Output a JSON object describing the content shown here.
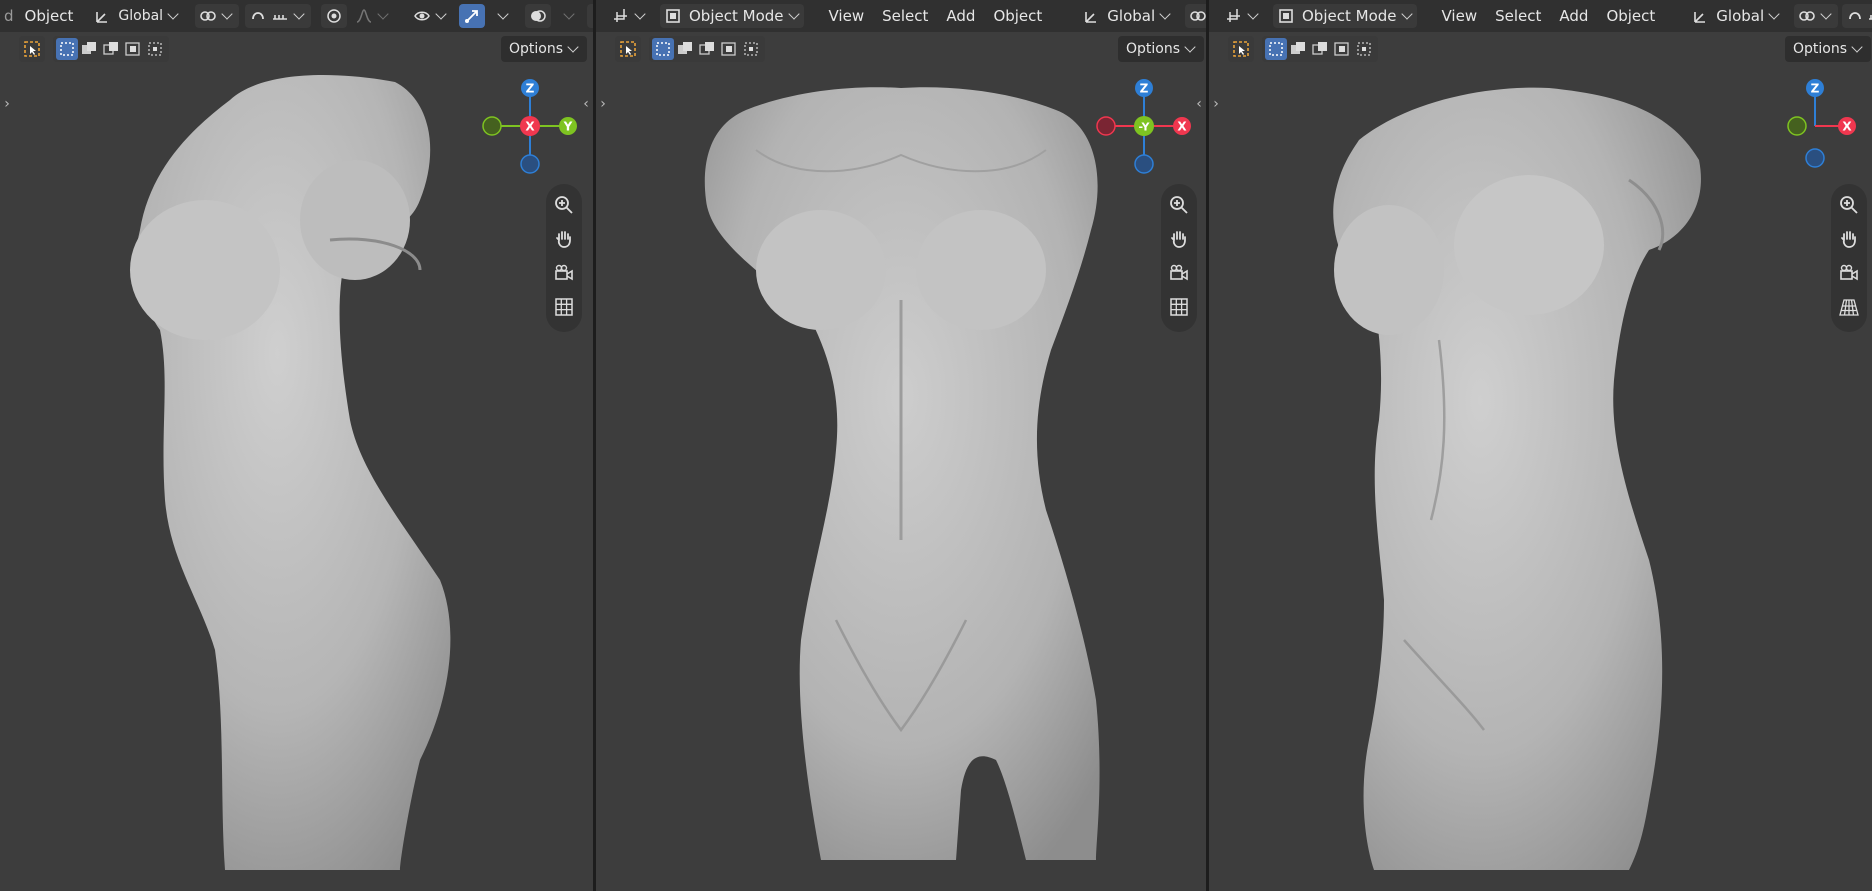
{
  "panes": [
    {
      "header": {
        "partial_label": "d",
        "object_menu": "Object",
        "orientation": "Global"
      },
      "options_label": "Options",
      "gizmo": {
        "up": "Z",
        "center": "X",
        "right": "Y"
      }
    },
    {
      "header": {
        "mode": "Object Mode",
        "menus": [
          "View",
          "Select",
          "Add",
          "Object"
        ],
        "orientation": "Global"
      },
      "options_label": "Options",
      "gizmo": {
        "up": "Z",
        "center": "-Y",
        "right": "X"
      }
    },
    {
      "header": {
        "mode": "Object Mode",
        "menus": [
          "View",
          "Select",
          "Add",
          "Object"
        ],
        "orientation": "Global"
      },
      "options_label": "Options",
      "gizmo": {
        "up": "Z",
        "right": "X"
      }
    }
  ],
  "colors": {
    "viewport_bg": "#3d3d3d",
    "header_bg": "#303030",
    "active_blue": "#4772b3",
    "axis_x": "#f0374f",
    "axis_y": "#7ec321",
    "axis_z": "#2e7fd6",
    "select_tool_orange": "#e8a23a",
    "sculpt_grey": "#b8b8b8"
  },
  "icons": [
    "object-origin-icon",
    "transform-orientation-icon",
    "pivot-icon",
    "snap-icon",
    "proportional-edit-icon",
    "visibility-icon",
    "gizmo-icon",
    "overlay-icon",
    "xray-icon",
    "select-box-icon",
    "zoom-icon",
    "pan-hand-icon",
    "camera-view-icon",
    "ortho-grid-icon",
    "perspective-grid-icon",
    "editor-type-icon"
  ]
}
